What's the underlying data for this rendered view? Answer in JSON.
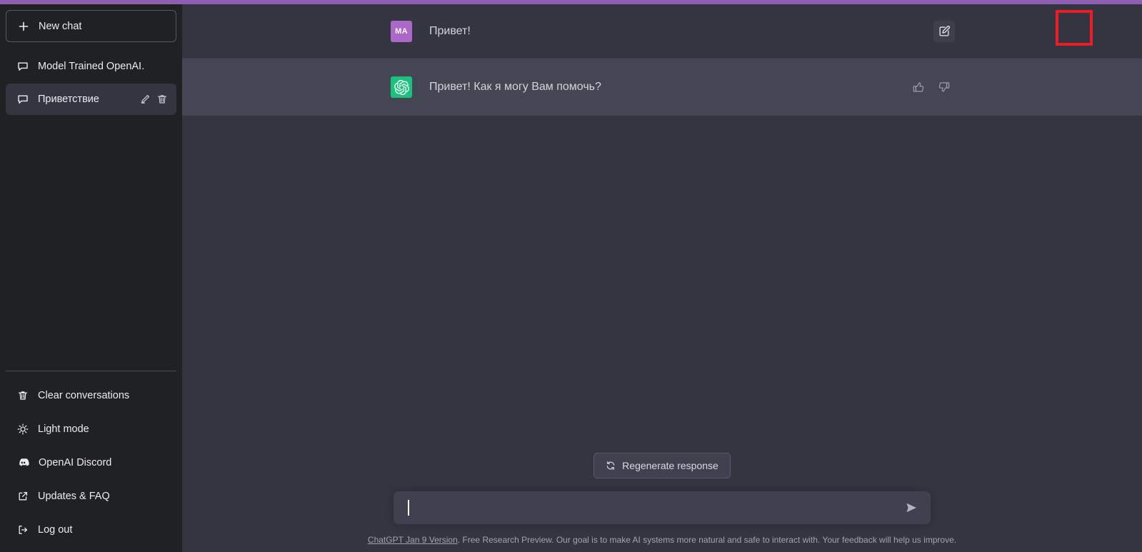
{
  "accent_color": "#8c5fb0",
  "sidebar": {
    "new_chat": {
      "label": "New chat",
      "icon": "plus-icon"
    },
    "conversations": [
      {
        "label": "Model Trained OpenAI.",
        "icon": "chat-bubble-icon",
        "active": false
      },
      {
        "label": "Приветствие",
        "icon": "chat-bubble-icon",
        "active": true
      }
    ],
    "conversation_actions": {
      "edit": "edit-pencil-icon",
      "delete": "trash-icon"
    },
    "bottom_items": [
      {
        "label": "Clear conversations",
        "icon": "trash-icon"
      },
      {
        "label": "Light mode",
        "icon": "sun-icon"
      },
      {
        "label": "OpenAI Discord",
        "icon": "discord-icon"
      },
      {
        "label": "Updates & FAQ",
        "icon": "external-link-icon"
      },
      {
        "label": "Log out",
        "icon": "logout-icon"
      }
    ]
  },
  "thread": {
    "messages": [
      {
        "role": "user",
        "avatar_initials": "MA",
        "avatar_color": "#ab68c8",
        "text": "Привет!",
        "actions": [
          {
            "name": "edit-message-icon",
            "highlighted": true
          }
        ]
      },
      {
        "role": "assistant",
        "avatar_icon": "openai-logo-icon",
        "avatar_color": "#19c37d",
        "text": "Привет! Как я могу Вам помочь?",
        "actions": [
          {
            "name": "thumbs-up-icon",
            "highlighted": false
          },
          {
            "name": "thumbs-down-icon",
            "highlighted": false
          }
        ]
      }
    ]
  },
  "composer": {
    "regenerate_label": "Regenerate response",
    "regenerate_icon": "refresh-icon",
    "input_value": "",
    "input_placeholder": "",
    "send_icon": "send-arrow-icon"
  },
  "footer": {
    "link_text": "ChatGPT Jan 9 Version",
    "rest_text": ". Free Research Preview. Our goal is to make AI systems more natural and safe to interact with. Your feedback will help us improve."
  },
  "annotation": {
    "color": "#ec1c24",
    "target": "edit-message-icon"
  }
}
